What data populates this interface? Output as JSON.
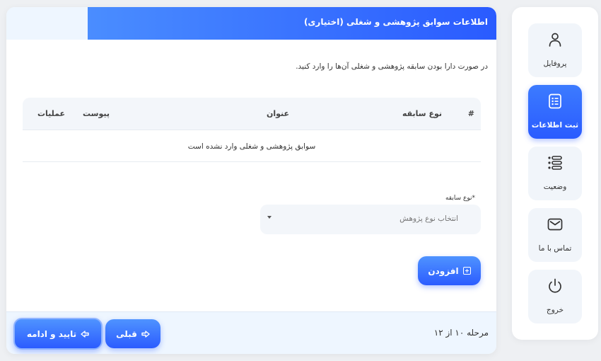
{
  "header": {
    "title": "اطلاعات سوابق پژوهشی و شغلی (اختیاری)"
  },
  "intro_text": "در صورت دارا بودن سابقه پژوهشی و شغلی آن‌ها را وارد کنید.",
  "table": {
    "columns": [
      "#",
      "نوع سابقه",
      "عنوان",
      "پیوست",
      "عملیات"
    ],
    "empty_message": "سوابق پژوهشی و شغلی وارد نشده است"
  },
  "form": {
    "type_label": "*نوع سابقه",
    "type_placeholder": "انتخاب نوع پژوهش",
    "add_button": "افزودن"
  },
  "footer": {
    "step_text": "مرحله ۱۰ از ۱۲",
    "prev_button": "قبلی",
    "next_button": "تایید و ادامه"
  },
  "sidebar": {
    "items": [
      {
        "label": "پروفایل",
        "icon": "user-icon",
        "active": false
      },
      {
        "label": "ثبت اطلاعات",
        "icon": "clipboard-icon",
        "active": true
      },
      {
        "label": "وضعیت",
        "icon": "list-icon",
        "active": false
      },
      {
        "label": "تماس با ما",
        "icon": "mail-icon",
        "active": false
      },
      {
        "label": "خروج",
        "icon": "power-icon",
        "active": false
      }
    ]
  },
  "colors": {
    "accent": "#2a5bff",
    "accent_light": "#4f93ff",
    "panel_bg": "#eef6ff"
  }
}
